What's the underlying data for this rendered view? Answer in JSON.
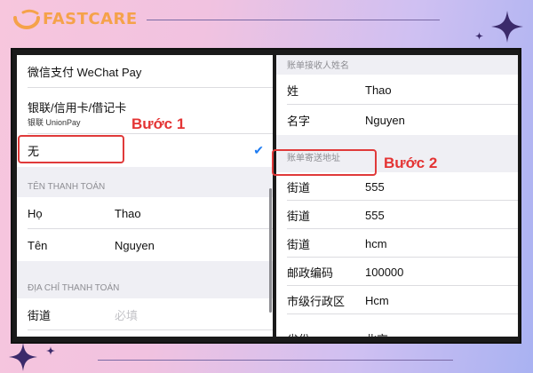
{
  "brand": {
    "name": "FASTCARE",
    "color": "#f5a24a"
  },
  "left_panel": {
    "payment_methods": [
      {
        "label": "微信支付 WeChat Pay"
      },
      {
        "label": "银联/信用卡/借记卡",
        "sublabel": "银联 UnionPay"
      },
      {
        "label": "无",
        "selected": true
      }
    ],
    "billing_name_header": "TÊN THANH TOÁN",
    "billing_name_rows": [
      {
        "label": "Họ",
        "value": "Thao"
      },
      {
        "label": "Tên",
        "value": "Nguyen"
      }
    ],
    "billing_address_header": "ĐỊA CHỈ THANH TOÁN",
    "billing_address_rows": [
      {
        "label": "街道",
        "placeholder": "必填"
      }
    ]
  },
  "right_panel": {
    "recipient_header": "账单接收人姓名",
    "recipient_rows": [
      {
        "label": "姓",
        "value": "Thao"
      },
      {
        "label": "名字",
        "value": "Nguyen"
      }
    ],
    "address_header": "账单寄送地址",
    "address_rows": [
      {
        "label": "街道",
        "value": "555"
      },
      {
        "label": "街道",
        "value": "555"
      },
      {
        "label": "街道",
        "value": "hcm"
      },
      {
        "label": "邮政编码",
        "value": "100000"
      },
      {
        "label": "市级行政区",
        "value": "Hcm"
      },
      {
        "label": "省份",
        "value": "北京"
      }
    ]
  },
  "annotations": {
    "step1": "Bước 1",
    "step2": "Bước 2",
    "color": "#e43434"
  },
  "icons": {
    "checkmark": "checkmark-icon",
    "sparkle": "sparkle-icon"
  }
}
